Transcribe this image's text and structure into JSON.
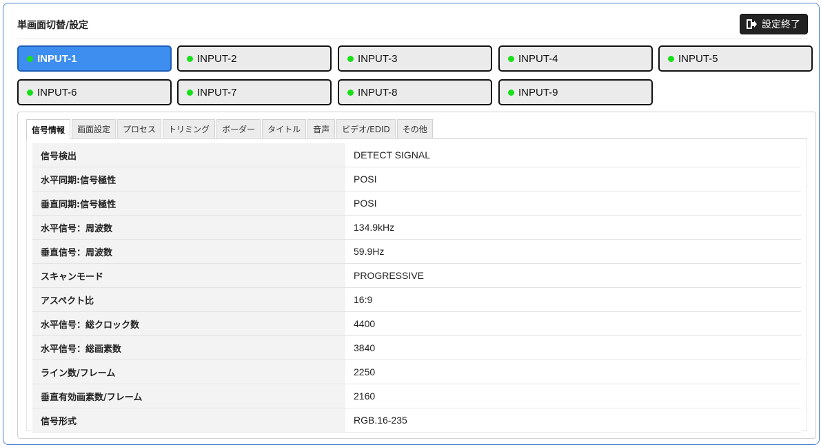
{
  "header": {
    "title": "単画面切替/設定",
    "exit_label": "設定終了"
  },
  "inputs": [
    {
      "label": "INPUT-1",
      "active": true
    },
    {
      "label": "INPUT-2",
      "active": false
    },
    {
      "label": "INPUT-3",
      "active": false
    },
    {
      "label": "INPUT-4",
      "active": false
    },
    {
      "label": "INPUT-5",
      "active": false
    },
    {
      "label": "INPUT-6",
      "active": false
    },
    {
      "label": "INPUT-7",
      "active": false
    },
    {
      "label": "INPUT-8",
      "active": false
    },
    {
      "label": "INPUT-9",
      "active": false
    }
  ],
  "status_color": "#18e018",
  "accent_color": "#3e8ef0",
  "tabs": [
    {
      "label": "信号情報",
      "active": true
    },
    {
      "label": "画面設定",
      "active": false
    },
    {
      "label": "プロセス",
      "active": false
    },
    {
      "label": "トリミング",
      "active": false
    },
    {
      "label": "ボーダー",
      "active": false
    },
    {
      "label": "タイトル",
      "active": false
    },
    {
      "label": "音声",
      "active": false
    },
    {
      "label": "ビデオ/EDID",
      "active": false
    },
    {
      "label": "その他",
      "active": false
    }
  ],
  "signal_info": [
    {
      "key": "信号検出",
      "value": "DETECT SIGNAL"
    },
    {
      "key": "水平同期:信号極性",
      "value": "POSI"
    },
    {
      "key": "垂直同期:信号極性",
      "value": "POSI"
    },
    {
      "key": "水平信号：周波数",
      "value": "134.9kHz"
    },
    {
      "key": "垂直信号：周波数",
      "value": "59.9Hz"
    },
    {
      "key": "スキャンモード",
      "value": "PROGRESSIVE"
    },
    {
      "key": "アスペクト比",
      "value": "16:9"
    },
    {
      "key": "水平信号：総クロック数",
      "value": "4400"
    },
    {
      "key": "水平信号：総画素数",
      "value": "3840"
    },
    {
      "key": "ライン数/フレーム",
      "value": "2250"
    },
    {
      "key": "垂直有効画素数/フレーム",
      "value": "2160"
    },
    {
      "key": "信号形式",
      "value": "RGB.16-235"
    }
  ]
}
